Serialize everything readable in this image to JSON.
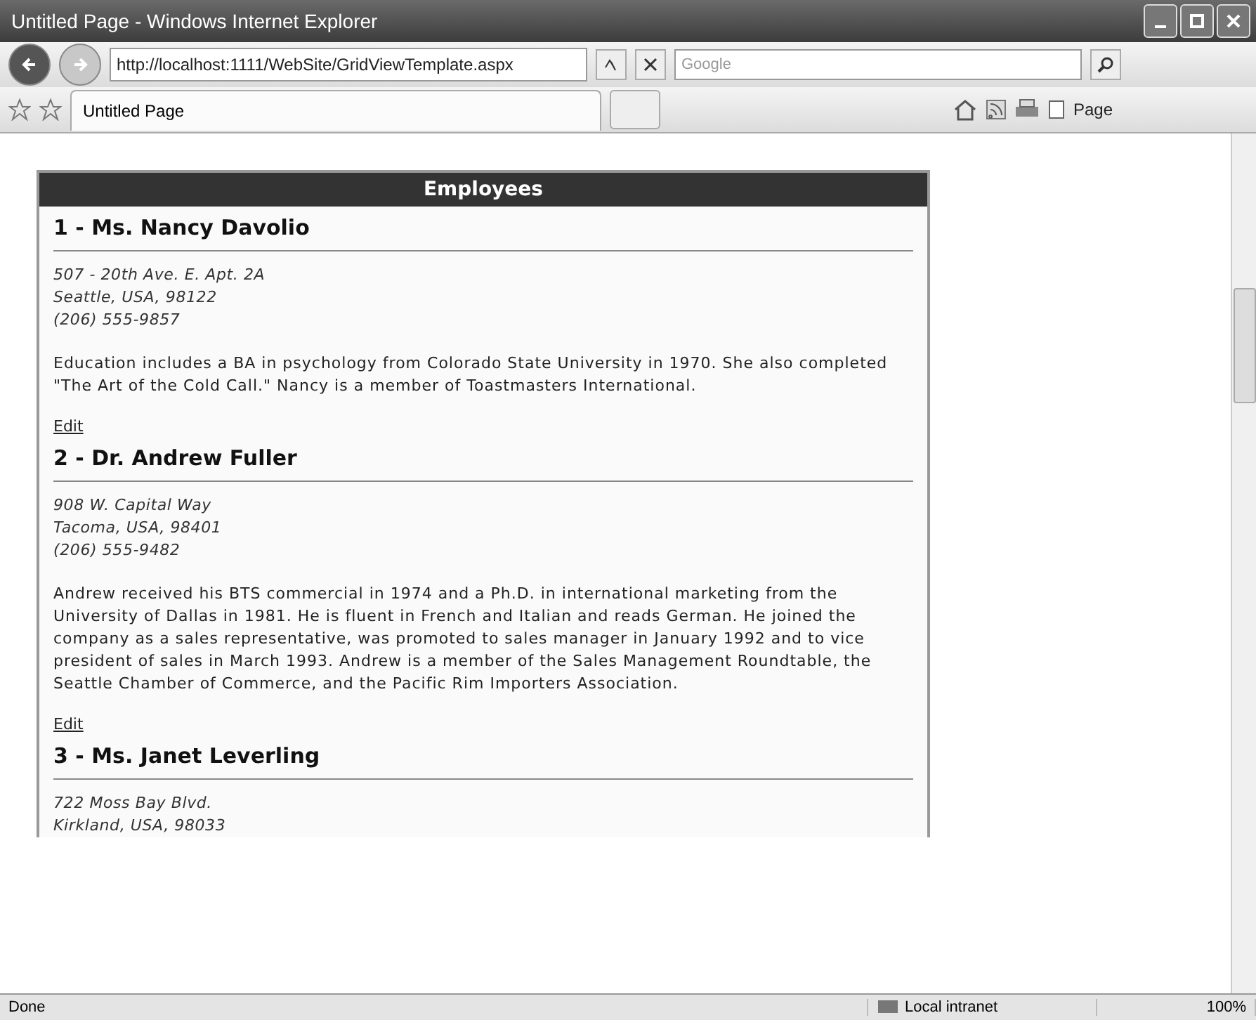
{
  "window": {
    "title": "Untitled Page - Windows Internet Explorer"
  },
  "address_bar": {
    "url": "http://localhost:1111/WebSite/GridViewTemplate.aspx",
    "search_placeholder": "Google"
  },
  "tabs": [
    {
      "label": "Untitled Page",
      "selected": true
    }
  ],
  "command_bar": {
    "page_menu": "Page"
  },
  "grid": {
    "header": "Employees",
    "employees": [
      {
        "heading": "1 - Ms. Nancy Davolio",
        "address_lines": [
          "507 - 20th Ave. E. Apt. 2A",
          "Seattle, USA, 98122",
          "(206) 555-9857"
        ],
        "notes": "Education includes a BA in psychology from Colorado State University in 1970. She also completed \"The Art of the Cold Call.\" Nancy is a member of Toastmasters International.",
        "edit_link": "Edit"
      },
      {
        "heading": "2 - Dr. Andrew Fuller",
        "address_lines": [
          "908 W. Capital Way",
          "Tacoma, USA, 98401",
          "(206) 555-9482"
        ],
        "notes": "Andrew received his BTS commercial in 1974 and a Ph.D. in international marketing from the University of Dallas in 1981. He is fluent in French and Italian and reads German. He joined the company as a sales representative, was promoted to sales manager in January 1992 and to vice president of sales in March 1993. Andrew is a member of the Sales Management Roundtable, the Seattle Chamber of Commerce, and the Pacific Rim Importers Association.",
        "edit_link": "Edit"
      },
      {
        "heading": "3 - Ms. Janet Leverling",
        "address_lines": [
          "722 Moss Bay Blvd.",
          "Kirkland, USA, 98033"
        ]
      }
    ]
  },
  "status_bar": {
    "status": "Done",
    "zone": "Local intranet",
    "zoom": "100%"
  }
}
